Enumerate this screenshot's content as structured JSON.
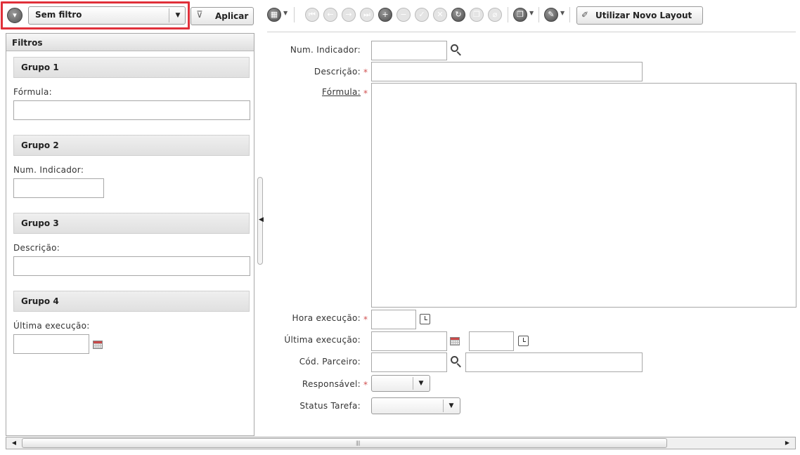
{
  "toolbar": {
    "filter_select_value": "Sem filtro",
    "apply_label": "Aplicar",
    "new_layout_label": "Utilizar Novo Layout",
    "icons": [
      "grid-icon",
      "first-record-icon",
      "previous-record-icon",
      "next-record-icon",
      "last-record-icon",
      "add-icon",
      "remove-icon",
      "confirm-icon",
      "cancel-icon",
      "refresh-icon",
      "copy-icon",
      "attach-icon",
      "clone-icon",
      "wrench-icon",
      "brush-icon"
    ]
  },
  "filters_panel": {
    "title": "Filtros",
    "groups": [
      {
        "name": "Grupo 1",
        "field_label": "Fórmula:"
      },
      {
        "name": "Grupo 2",
        "field_label": "Num. Indicador:"
      },
      {
        "name": "Grupo 3",
        "field_label": "Descrição:"
      },
      {
        "name": "Grupo 4",
        "field_label": "Última execução:"
      }
    ]
  },
  "form": {
    "num_indicador_label": "Num. Indicador:",
    "descricao_label": "Descrição:",
    "formula_label": "Fórmula:",
    "hora_execucao_label": "Hora execução:",
    "ultima_execucao_label": "Última execução:",
    "cod_parceiro_label": "Cód. Parceiro:",
    "responsavel_label": "Responsável:",
    "status_tarefa_label": "Status Tarefa:",
    "required_mark": "*"
  },
  "colors": {
    "highlight": "#e0303a",
    "required": "#d05050"
  }
}
